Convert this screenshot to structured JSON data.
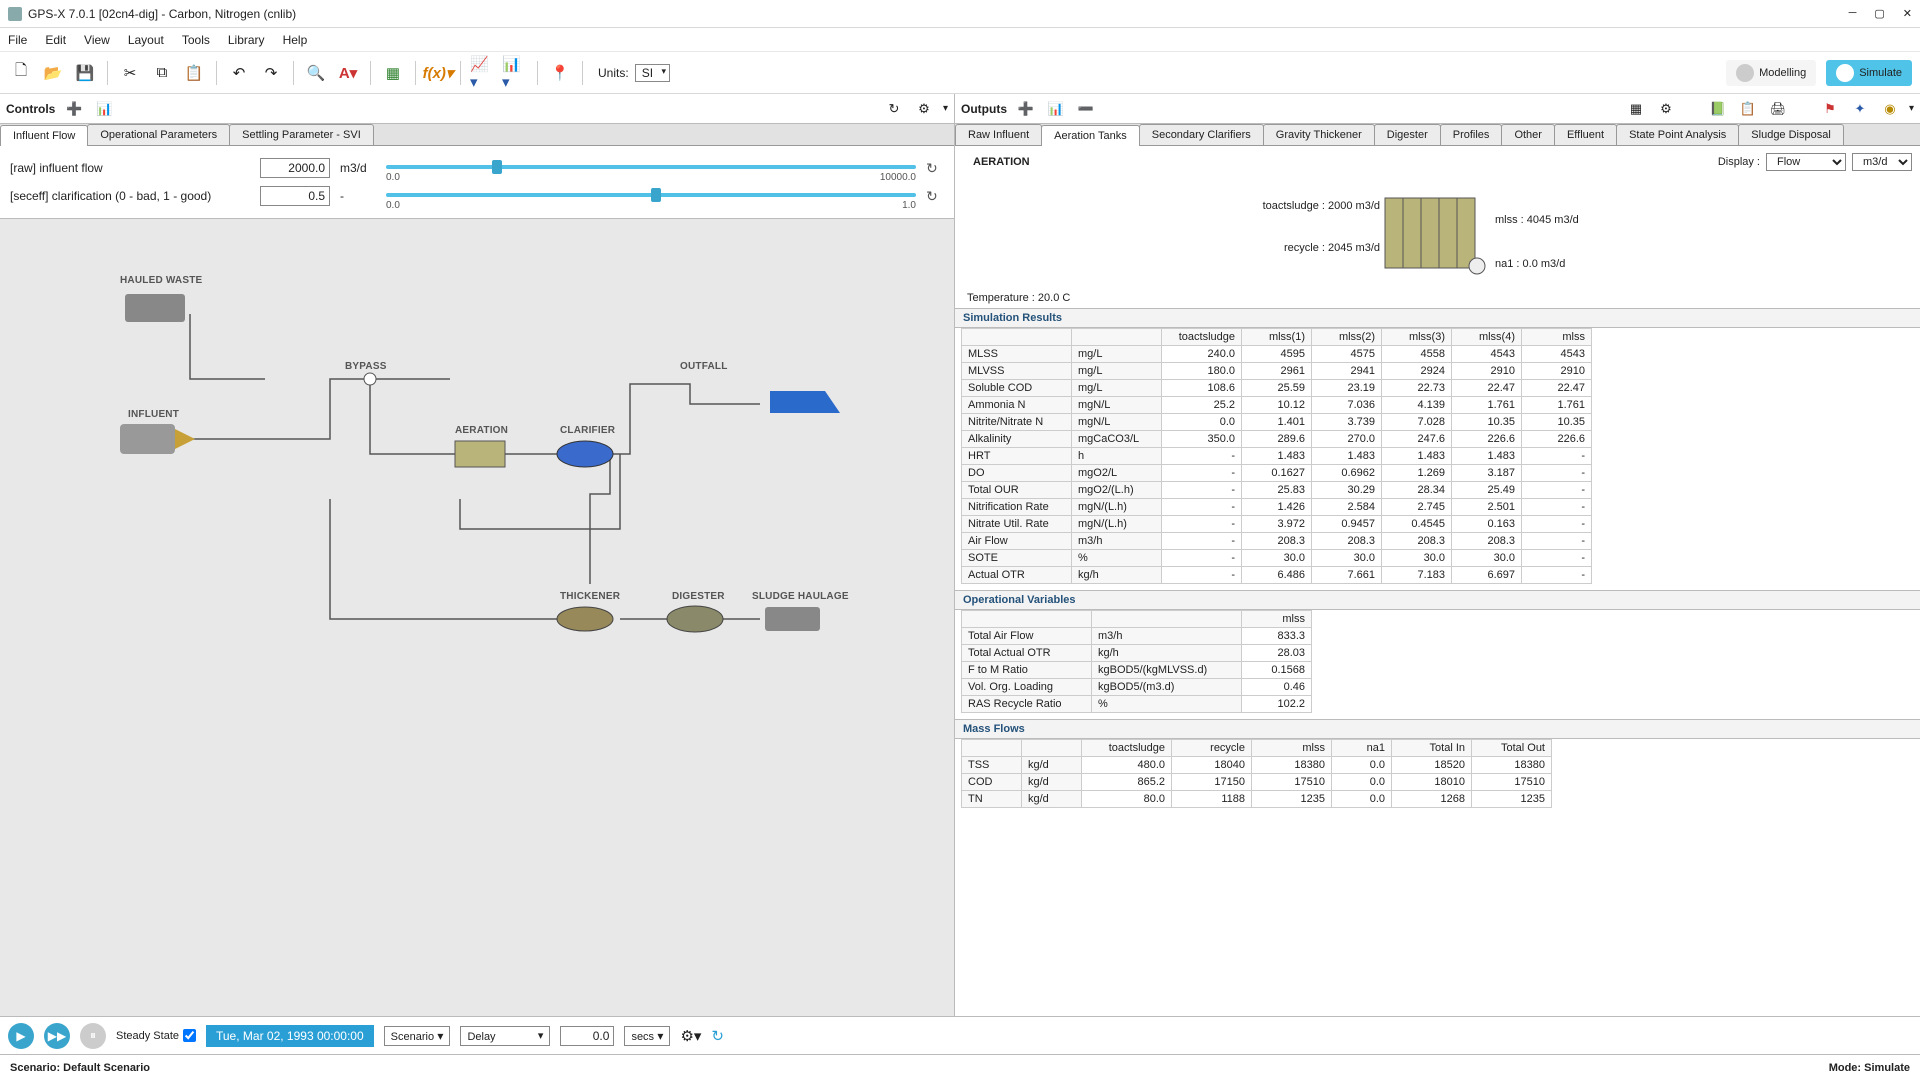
{
  "window": {
    "title": "GPS-X 7.0.1 [02cn4-dig] - Carbon, Nitrogen (cnlib)"
  },
  "menu": [
    "File",
    "Edit",
    "View",
    "Layout",
    "Tools",
    "Library",
    "Help"
  ],
  "toolbar": {
    "units_label": "Units:",
    "units_value": "SI",
    "mode_modelling": "Modelling",
    "mode_simulate": "Simulate"
  },
  "controls": {
    "header": "Controls",
    "tabs": [
      "Influent Flow",
      "Operational Parameters",
      "Settling Parameter - SVI"
    ],
    "rows": [
      {
        "label": "[raw] influent flow",
        "value": "2000.0",
        "unit": "m3/d",
        "min": "0.0",
        "max": "10000.0",
        "pos": 20
      },
      {
        "label": "[seceff] clarification (0 - bad, 1 - good)",
        "value": "0.5",
        "unit": "-",
        "min": "0.0",
        "max": "1.0",
        "pos": 50
      }
    ]
  },
  "layout_labels": {
    "hauled": "HAULED WASTE",
    "bypass": "BYPASS",
    "outfall": "OUTFALL",
    "influent": "INFLUENT",
    "aeration": "AERATION",
    "clarifier": "CLARIFIER",
    "thickener": "THICKENER",
    "digester": "DIGESTER",
    "haulage": "SLUDGE HAULAGE"
  },
  "outputs": {
    "header": "Outputs",
    "tabs": [
      "Raw Influent",
      "Aeration Tanks",
      "Secondary Clarifiers",
      "Gravity Thickener",
      "Digester",
      "Profiles",
      "Other",
      "Effluent",
      "State Point Analysis",
      "Sludge Disposal"
    ],
    "active_tab": 1,
    "display_label": "Display :",
    "display_value": "Flow",
    "display_unit": "m3/d",
    "aeration_title": "AERATION",
    "aer_labels": {
      "toact": "toactsludge : 2000 m3/d",
      "recycle": "recycle : 2045 m3/d",
      "mlss": "mlss : 4045 m3/d",
      "na1": "na1 : 0.0 m3/d"
    },
    "temperature": "Temperature :  20.0  C",
    "sections": {
      "sim": "Simulation Results",
      "op": "Operational Variables",
      "mass": "Mass Flows"
    },
    "sim_headers": [
      "",
      "",
      "toactsludge",
      "mlss(1)",
      "mlss(2)",
      "mlss(3)",
      "mlss(4)",
      "mlss"
    ],
    "sim_rows": [
      [
        "MLSS",
        "mg/L",
        "240.0",
        "4595",
        "4575",
        "4558",
        "4543",
        "4543"
      ],
      [
        "MLVSS",
        "mg/L",
        "180.0",
        "2961",
        "2941",
        "2924",
        "2910",
        "2910"
      ],
      [
        "Soluble COD",
        "mg/L",
        "108.6",
        "25.59",
        "23.19",
        "22.73",
        "22.47",
        "22.47"
      ],
      [
        "Ammonia N",
        "mgN/L",
        "25.2",
        "10.12",
        "7.036",
        "4.139",
        "1.761",
        "1.761"
      ],
      [
        "Nitrite/Nitrate N",
        "mgN/L",
        "0.0",
        "1.401",
        "3.739",
        "7.028",
        "10.35",
        "10.35"
      ],
      [
        "Alkalinity",
        "mgCaCO3/L",
        "350.0",
        "289.6",
        "270.0",
        "247.6",
        "226.6",
        "226.6"
      ],
      [
        "HRT",
        "h",
        "-",
        "1.483",
        "1.483",
        "1.483",
        "1.483",
        "-"
      ],
      [
        "DO",
        "mgO2/L",
        "-",
        "0.1627",
        "0.6962",
        "1.269",
        "3.187",
        "-"
      ],
      [
        "Total OUR",
        "mgO2/(L.h)",
        "-",
        "25.83",
        "30.29",
        "28.34",
        "25.49",
        "-"
      ],
      [
        "Nitrification Rate",
        "mgN/(L.h)",
        "-",
        "1.426",
        "2.584",
        "2.745",
        "2.501",
        "-"
      ],
      [
        "Nitrate Util. Rate",
        "mgN/(L.h)",
        "-",
        "3.972",
        "0.9457",
        "0.4545",
        "0.163",
        "-"
      ],
      [
        "Air Flow",
        "m3/h",
        "-",
        "208.3",
        "208.3",
        "208.3",
        "208.3",
        "-"
      ],
      [
        "SOTE",
        "%",
        "-",
        "30.0",
        "30.0",
        "30.0",
        "30.0",
        "-"
      ],
      [
        "Actual OTR",
        "kg/h",
        "-",
        "6.486",
        "7.661",
        "7.183",
        "6.697",
        "-"
      ]
    ],
    "op_headers": [
      "",
      "",
      "mlss"
    ],
    "op_rows": [
      [
        "Total Air Flow",
        "m3/h",
        "833.3"
      ],
      [
        "Total Actual OTR",
        "kg/h",
        "28.03"
      ],
      [
        "F to M Ratio",
        "kgBOD5/(kgMLVSS.d)",
        "0.1568"
      ],
      [
        "Vol. Org.  Loading",
        "kgBOD5/(m3.d)",
        "0.46"
      ],
      [
        "RAS Recycle Ratio",
        "%",
        "102.2"
      ]
    ],
    "mass_headers": [
      "",
      "",
      "toactsludge",
      "recycle",
      "mlss",
      "na1",
      "Total In",
      "Total Out"
    ],
    "mass_rows": [
      [
        "TSS",
        "kg/d",
        "480.0",
        "18040",
        "18380",
        "0.0",
        "18520",
        "18380"
      ],
      [
        "COD",
        "kg/d",
        "865.2",
        "17150",
        "17510",
        "0.0",
        "18010",
        "17510"
      ],
      [
        "TN",
        "kg/d",
        "80.0",
        "1188",
        "1235",
        "0.0",
        "1268",
        "1235"
      ]
    ]
  },
  "simbar": {
    "steady": "Steady State",
    "time": "Tue, Mar 02, 1993  00:00:00",
    "scenario": "Scenario",
    "delay": "Delay",
    "num": "0.0",
    "unit": "secs"
  },
  "status": {
    "left": "Scenario: Default Scenario",
    "right": "Mode: Simulate"
  }
}
